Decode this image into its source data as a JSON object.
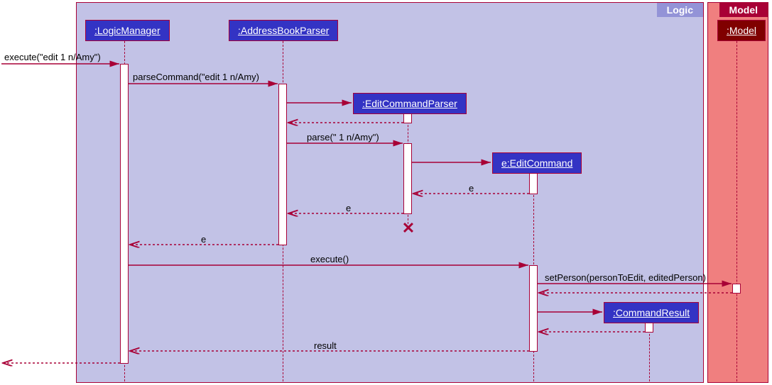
{
  "frames": {
    "logic": {
      "label": "Logic"
    },
    "model": {
      "label": "Model"
    }
  },
  "participants": {
    "logicManager": ":LogicManager",
    "addressBookParser": ":AddressBookParser",
    "editCommandParser": ":EditCommandParser",
    "editCommand": "e:EditCommand",
    "commandResult": ":CommandResult",
    "model": ":Model"
  },
  "messages": {
    "execute": "execute(\"edit 1 n/Amy\")",
    "parseCommand": "parseCommand(\"edit 1 n/Amy)",
    "parse": "parse(\" 1 n/Amy\")",
    "return_e1": "e",
    "return_e2": "e",
    "return_e3": "e",
    "executeCall": "execute()",
    "setPerson": "setPerson(personToEdit, editedPerson)",
    "result": "result"
  },
  "chart_data": {
    "type": "sequence_diagram",
    "frames": [
      {
        "name": "Logic",
        "participants": [
          "LogicManager",
          "AddressBookParser",
          "EditCommandParser",
          "EditCommand",
          "CommandResult"
        ]
      },
      {
        "name": "Model",
        "participants": [
          "Model"
        ]
      }
    ],
    "participants": [
      {
        "id": "caller",
        "label": "(external)"
      },
      {
        "id": "LogicManager",
        "label": ":LogicManager"
      },
      {
        "id": "AddressBookParser",
        "label": ":AddressBookParser"
      },
      {
        "id": "EditCommandParser",
        "label": ":EditCommandParser",
        "created_by_msg": 3,
        "destroyed_after_msg": 7
      },
      {
        "id": "EditCommand",
        "label": "e:EditCommand",
        "created_by_msg": 5
      },
      {
        "id": "CommandResult",
        "label": ":CommandResult",
        "created_by_msg": 12
      },
      {
        "id": "Model",
        "label": ":Model"
      }
    ],
    "messages": [
      {
        "n": 1,
        "from": "caller",
        "to": "LogicManager",
        "label": "execute(\"edit 1 n/Amy\")",
        "kind": "call"
      },
      {
        "n": 2,
        "from": "LogicManager",
        "to": "AddressBookParser",
        "label": "parseCommand(\"edit 1 n/Amy)",
        "kind": "call"
      },
      {
        "n": 3,
        "from": "AddressBookParser",
        "to": "EditCommandParser",
        "label": "",
        "kind": "create"
      },
      {
        "n": 4,
        "from": "EditCommandParser",
        "to": "AddressBookParser",
        "label": "",
        "kind": "return"
      },
      {
        "n": 5,
        "from": "AddressBookParser",
        "to": "EditCommandParser",
        "label": "parse(\" 1 n/Amy\")",
        "kind": "call"
      },
      {
        "n": 6,
        "from": "EditCommandParser",
        "to": "EditCommand",
        "label": "",
        "kind": "create"
      },
      {
        "n": 7,
        "from": "EditCommand",
        "to": "EditCommandParser",
        "label": "e",
        "kind": "return"
      },
      {
        "n": 8,
        "from": "EditCommandParser",
        "to": "AddressBookParser",
        "label": "e",
        "kind": "return"
      },
      {
        "n": 9,
        "from": "AddressBookParser",
        "to": "LogicManager",
        "label": "e",
        "kind": "return"
      },
      {
        "n": 10,
        "from": "LogicManager",
        "to": "EditCommand",
        "label": "execute()",
        "kind": "call"
      },
      {
        "n": 11,
        "from": "EditCommand",
        "to": "Model",
        "label": "setPerson(personToEdit, editedPerson)",
        "kind": "call"
      },
      {
        "n": 12,
        "from": "Model",
        "to": "EditCommand",
        "label": "",
        "kind": "return"
      },
      {
        "n": 13,
        "from": "EditCommand",
        "to": "CommandResult",
        "label": "",
        "kind": "create"
      },
      {
        "n": 14,
        "from": "CommandResult",
        "to": "EditCommand",
        "label": "",
        "kind": "return"
      },
      {
        "n": 15,
        "from": "EditCommand",
        "to": "LogicManager",
        "label": "result",
        "kind": "return"
      },
      {
        "n": 16,
        "from": "LogicManager",
        "to": "caller",
        "label": "",
        "kind": "return"
      }
    ]
  }
}
